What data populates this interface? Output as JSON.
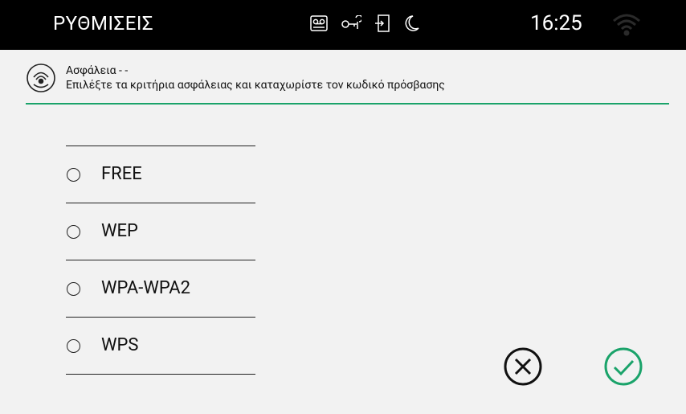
{
  "statusbar": {
    "title": "ΡΥΘΜΙΣΕΙΣ",
    "time": "16:25",
    "icons": [
      "voicemail-icon",
      "key-icon",
      "door-exit-icon",
      "moon-icon"
    ],
    "wifi_icon": "wifi-icon"
  },
  "header": {
    "title": "Ασφάλεια - -",
    "subtitle": "Επιλέξτε τα κριτήρια ασφάλειας και καταχωρίστε τον κωδικό πρόσβασης",
    "icon": "wireless-signal-icon",
    "accent_color": "#1aa36a"
  },
  "security_options": [
    {
      "label": "FREE"
    },
    {
      "label": "WEP"
    },
    {
      "label": "WPA-WPA2"
    },
    {
      "label": "WPS"
    }
  ],
  "actions": {
    "cancel_icon": "cancel-circle-icon",
    "confirm_icon": "check-circle-icon",
    "confirm_color": "#1aa36a"
  }
}
